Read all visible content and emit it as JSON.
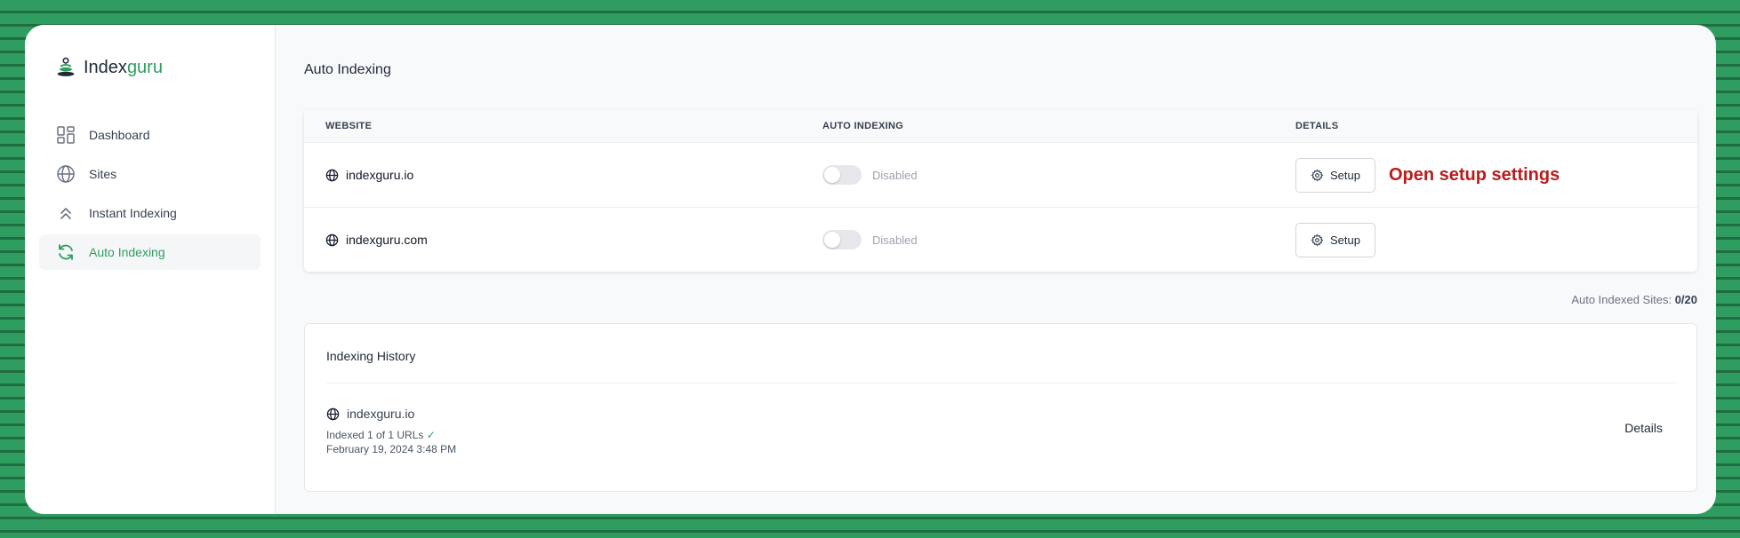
{
  "brand": {
    "name_part1": "Index",
    "name_part2": "guru"
  },
  "nav": {
    "items": [
      {
        "label": "Dashboard"
      },
      {
        "label": "Sites"
      },
      {
        "label": "Instant Indexing"
      },
      {
        "label": "Auto Indexing"
      }
    ]
  },
  "page": {
    "title": "Auto Indexing"
  },
  "table": {
    "headers": {
      "website": "WEBSITE",
      "auto": "AUTO INDEXING",
      "details": "DETAILS"
    },
    "rows": [
      {
        "site": "indexguru.io",
        "status": "Disabled",
        "button": "Setup"
      },
      {
        "site": "indexguru.com",
        "status": "Disabled",
        "button": "Setup"
      }
    ]
  },
  "annotation": "Open setup settings",
  "summary": {
    "label": "Auto Indexed Sites:",
    "value": "0/20"
  },
  "history": {
    "title": "Indexing History",
    "items": [
      {
        "site": "indexguru.io",
        "indexed": "Indexed 1 of 1 URLs",
        "date": "February 19, 2024 3:48 PM",
        "details": "Details"
      }
    ]
  },
  "colors": {
    "brand": "#2f9d5f",
    "annotation": "#b91c1c"
  }
}
